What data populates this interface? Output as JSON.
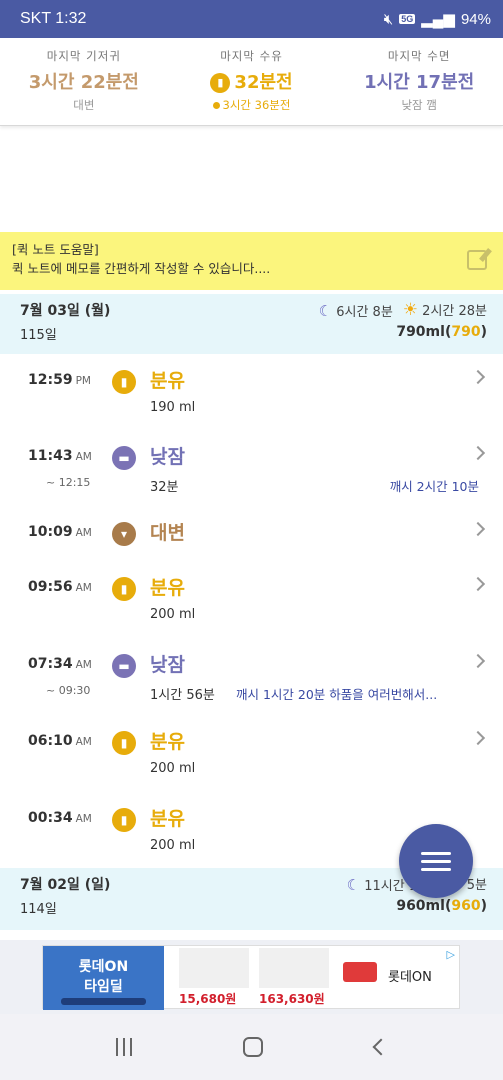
{
  "status_bar": {
    "carrier_time": "SKT 1:32",
    "network": "5G",
    "battery": "94%"
  },
  "summary": {
    "diaper": {
      "label": "마지막 기저귀",
      "value": "3시간 22분전",
      "sub": "대변"
    },
    "feeding": {
      "label": "마지막 수유",
      "value": "32분전",
      "sub": "3시간 36분전"
    },
    "sleep": {
      "label": "마지막 수면",
      "value": "1시간 17분전",
      "sub": "낮잠 깸"
    }
  },
  "quick_note": {
    "title": "[퀵 노트 도움말]",
    "text": "퀵 노트에 메모를 간편하게 작성할 수 있습니다...."
  },
  "days": [
    {
      "date": "7월 03일 (월)",
      "age": "115일",
      "night_sleep": "6시간 8분",
      "day_sleep": "2시간 28분",
      "total_ml": "790ml",
      "total_ml_paren": "790",
      "entries": [
        {
          "time": "12:59",
          "ampm": "PM",
          "type": "feed",
          "title": "분유",
          "detail": "190 ml"
        },
        {
          "time": "11:43",
          "ampm": "AM",
          "end": "~ 12:15",
          "type": "sleep",
          "title": "낮잠",
          "detail": "32분",
          "note": "깨시 2시간 10분"
        },
        {
          "time": "10:09",
          "ampm": "AM",
          "type": "poop",
          "title": "대변"
        },
        {
          "time": "09:56",
          "ampm": "AM",
          "type": "feed",
          "title": "분유",
          "detail": "200 ml"
        },
        {
          "time": "07:34",
          "ampm": "AM",
          "end": "~ 09:30",
          "type": "sleep",
          "title": "낮잠",
          "detail": "1시간 56분",
          "note": "깨시 1시간 20분 하품을 여러번해서..."
        },
        {
          "time": "06:10",
          "ampm": "AM",
          "type": "feed",
          "title": "분유",
          "detail": "200 ml"
        },
        {
          "time": "00:34",
          "ampm": "AM",
          "type": "feed",
          "title": "분유",
          "detail": "200 ml"
        }
      ]
    },
    {
      "date": "7월 02일 (일)",
      "age": "114일",
      "night_sleep": "11시간 16분",
      "day_sleep": "5분",
      "total_ml": "960ml",
      "total_ml_paren": "960"
    }
  ],
  "ad": {
    "banner_line1": "롯데ON",
    "banner_line2": "타임딜",
    "price1": "15,680원",
    "price2": "163,630원",
    "brand": "롯데ON"
  },
  "colors": {
    "primary": "#4a5aa3",
    "feed": "#e7ac0b",
    "sleep": "#7271b5",
    "poop": "#b48552",
    "note_bg": "#fbf57d",
    "day_bg": "#e6f6fa"
  }
}
